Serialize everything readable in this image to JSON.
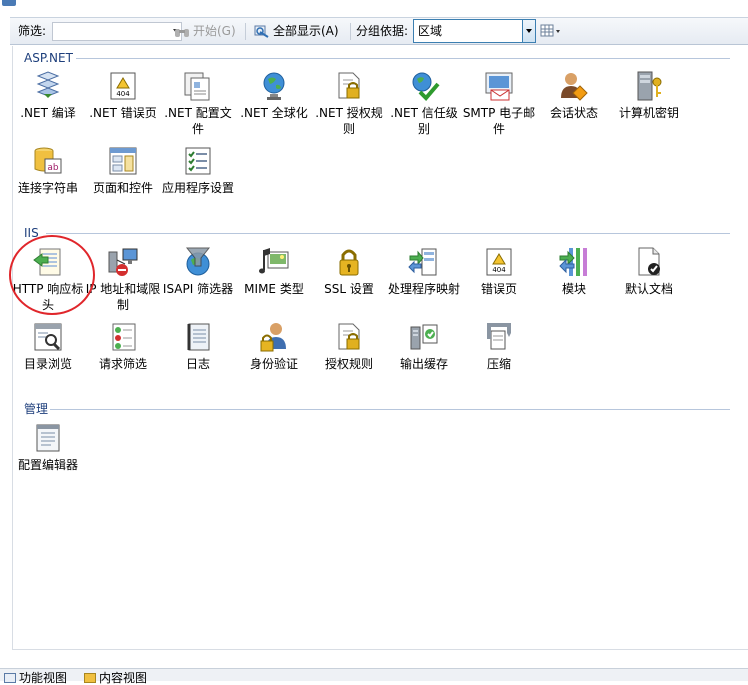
{
  "toolbar": {
    "filter_label": "筛选:",
    "filter_value": "",
    "start_label": "开始(G)",
    "show_all_label": "全部显示(A)",
    "group_by_label": "分组依据:",
    "group_by_value": "区域"
  },
  "groups": {
    "aspnet": {
      "title": "ASP.NET",
      "items": [
        {
          "label": ".NET 编译",
          "icon": "dotnet-compile-icon"
        },
        {
          "label": ".NET 错误页",
          "icon": "dotnet-error-pages-icon"
        },
        {
          "label": ".NET 配置文件",
          "icon": "dotnet-profile-icon"
        },
        {
          "label": ".NET 全球化",
          "icon": "dotnet-globalization-icon"
        },
        {
          "label": ".NET 授权规则",
          "icon": "dotnet-authorization-icon"
        },
        {
          "label": ".NET 信任级别",
          "icon": "dotnet-trust-levels-icon"
        },
        {
          "label": "SMTP 电子邮件",
          "icon": "smtp-email-icon"
        },
        {
          "label": "会话状态",
          "icon": "session-state-icon"
        },
        {
          "label": "计算机密钥",
          "icon": "machine-key-icon"
        },
        {
          "label": "连接字符串",
          "icon": "connection-strings-icon"
        },
        {
          "label": "页面和控件",
          "icon": "pages-controls-icon"
        },
        {
          "label": "应用程序设置",
          "icon": "app-settings-icon"
        }
      ]
    },
    "iis": {
      "title": "IIS",
      "items": [
        {
          "label": "HTTP 响应标头",
          "icon": "http-response-headers-icon"
        },
        {
          "label": "IP 地址和域限制",
          "icon": "ip-domain-restrictions-icon"
        },
        {
          "label": "ISAPI 筛选器",
          "icon": "isapi-filters-icon"
        },
        {
          "label": "MIME 类型",
          "icon": "mime-types-icon"
        },
        {
          "label": "SSL 设置",
          "icon": "ssl-settings-icon"
        },
        {
          "label": "处理程序映射",
          "icon": "handler-mappings-icon"
        },
        {
          "label": "错误页",
          "icon": "error-pages-icon"
        },
        {
          "label": "模块",
          "icon": "modules-icon"
        },
        {
          "label": "默认文档",
          "icon": "default-document-icon"
        },
        {
          "label": "目录浏览",
          "icon": "directory-browsing-icon"
        },
        {
          "label": "请求筛选",
          "icon": "request-filtering-icon"
        },
        {
          "label": "日志",
          "icon": "logging-icon"
        },
        {
          "label": "身份验证",
          "icon": "authentication-icon"
        },
        {
          "label": "授权规则",
          "icon": "authorization-rules-icon"
        },
        {
          "label": "输出缓存",
          "icon": "output-caching-icon"
        },
        {
          "label": "压缩",
          "icon": "compression-icon"
        }
      ]
    },
    "management": {
      "title": "管理",
      "items": [
        {
          "label": "配置编辑器",
          "icon": "configuration-editor-icon"
        }
      ]
    }
  },
  "bottom_tabs": {
    "features_view": "功能视图",
    "content_view": "内容视图"
  },
  "colors": {
    "group_title": "#1e3f7c",
    "highlight_circle": "#e0262b",
    "combo_border": "#3c7fb1"
  }
}
